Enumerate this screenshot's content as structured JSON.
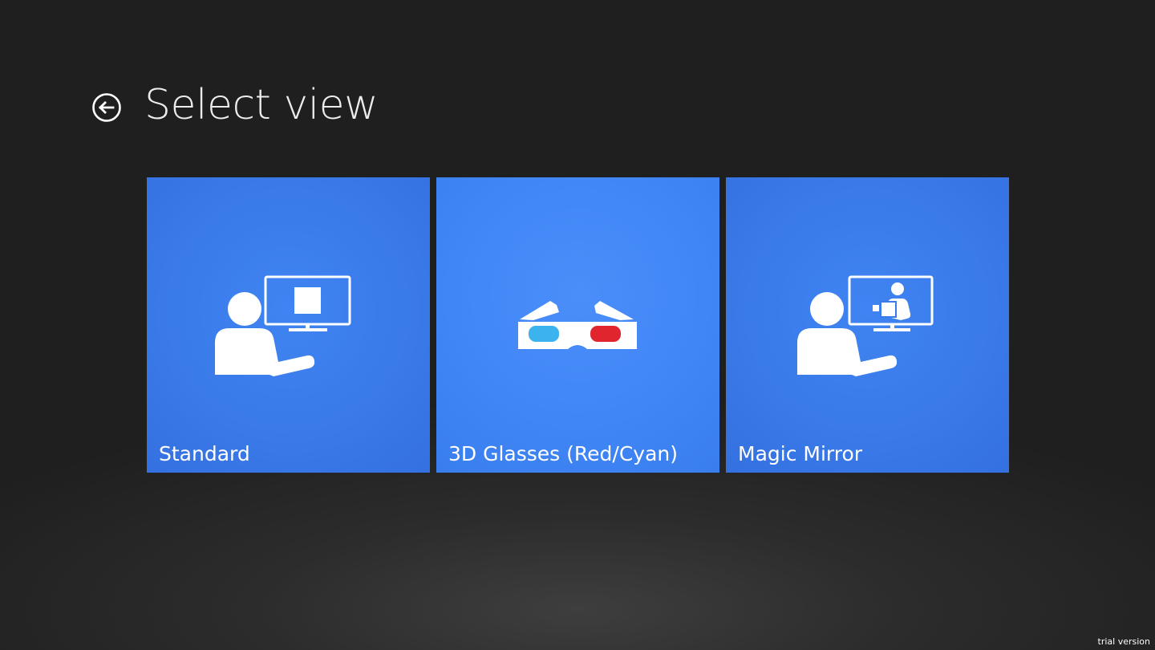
{
  "header": {
    "back_icon": "back-arrow-circle-icon",
    "title": "Select view"
  },
  "tiles": [
    {
      "label": "Standard",
      "icon": "person-monitor-icon"
    },
    {
      "label": "3D Glasses (Red/Cyan)",
      "icon": "3d-glasses-icon"
    },
    {
      "label": "Magic Mirror",
      "icon": "person-monitor-mirror-icon"
    }
  ],
  "footer": {
    "trial_text": "trial version"
  },
  "colors": {
    "background": "#1f1f1f",
    "tile": "#3a7ae9",
    "lens_left": "#3cb3ec",
    "lens_right": "#e0252e"
  }
}
